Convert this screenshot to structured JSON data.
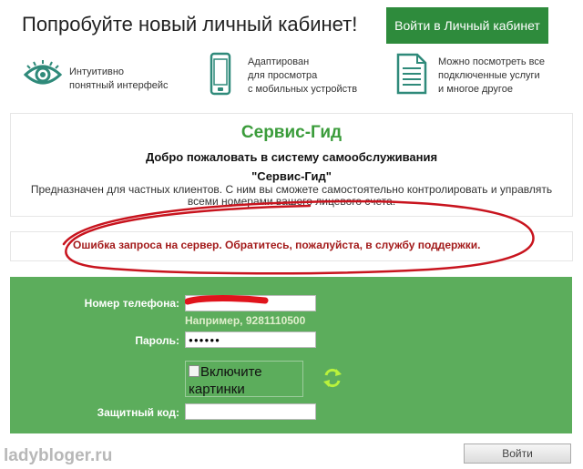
{
  "header": {
    "title": "Попробуйте новый личный кабинет!",
    "login_button": "Войти в Личный кабинет"
  },
  "features": [
    {
      "icon": "eye-icon",
      "line1": "Интуитивно",
      "line2": "понятный интерфейс",
      "line3": ""
    },
    {
      "icon": "phone-icon",
      "line1": "Адаптирован",
      "line2": "для просмотра",
      "line3": "с мобильных устройств"
    },
    {
      "icon": "document-icon",
      "line1": "Можно посмотреть все",
      "line2": "подключенные услуги",
      "line3": "и многое другое"
    }
  ],
  "info": {
    "title": "Сервис-Гид",
    "welcome": "Добро пожаловать в систему самообслуживания",
    "name": "\"Сервис-Гид\"",
    "description": "Предназначен для частных клиентов. С ним вы сможете самостоятельно контролировать и управлять всеми номерами вашего лицевого счета."
  },
  "error": {
    "message": "Ошибка запроса на сервер. Обратитесь, пожалуйста, в службу поддержки."
  },
  "form": {
    "phone_label": "Номер телефона:",
    "phone_value": "",
    "phone_hint": "Например, 9281110500",
    "password_label": "Пароль:",
    "password_value": "●●●●●●",
    "captcha_alt": "Включите картинки",
    "code_label": "Защитный код:",
    "code_value": "",
    "submit_label": "Войти"
  },
  "watermark": "ladybloger.ru",
  "colors": {
    "brand_green": "#2e8b3c",
    "panel_green": "#5cad5c",
    "title_green": "#3b9c3b",
    "error_red": "#a31b1b",
    "annotation_red": "#c8141e"
  }
}
